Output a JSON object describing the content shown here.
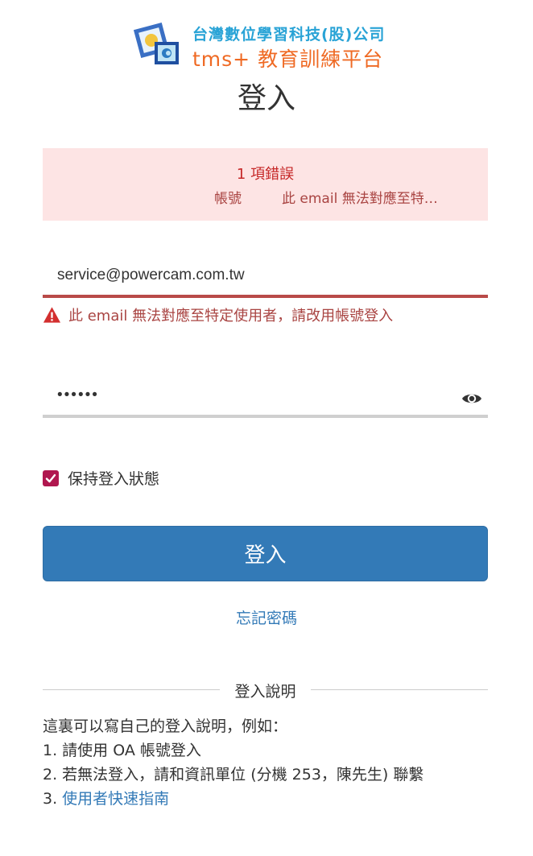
{
  "header": {
    "company_name": "台灣數位學習科技(股)公司",
    "product_name": "tms+ 教育訓練平台",
    "page_title": "登入"
  },
  "error_summary": {
    "count_text": "1 項錯誤",
    "field_label": "帳號",
    "message": "此 email 無法對應至特定使用者，請改用帳號登入"
  },
  "form": {
    "email_value": "service@powercam.com.tw",
    "email_error": "此 email 無法對應至特定使用者，請改用帳號登入",
    "password_value": "••••••",
    "remember_label": "保持登入狀態",
    "remember_checked": true,
    "submit_label": "登入",
    "forgot_label": "忘記密碼"
  },
  "help": {
    "divider_label": "登入說明",
    "intro": "這裏可以寫自己的登入說明，例如：",
    "line1": "1. 請使用 OA 帳號登入",
    "line2": "2. 若無法登入，請和資訊單位 (分機 253，陳先生) 聯繫",
    "line3_prefix": "3. ",
    "line3_link": "使用者快速指南"
  },
  "colors": {
    "accent": "#337ab7",
    "error": "#a94442",
    "error_bg": "#fde4e4",
    "checkbox": "#b0174f",
    "logo_blue": "#29a3d6",
    "logo_orange": "#ef6a24"
  }
}
